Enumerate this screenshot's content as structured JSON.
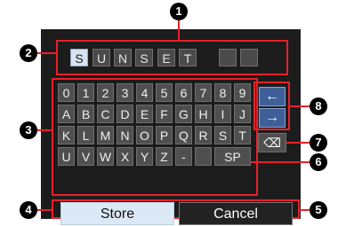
{
  "name_field": {
    "chars": [
      "S",
      "U",
      "N",
      "S",
      "E",
      "T",
      "",
      ""
    ]
  },
  "keyboard": {
    "rows": [
      [
        "0",
        "1",
        "2",
        "3",
        "4",
        "5",
        "6",
        "7",
        "8",
        "9"
      ],
      [
        "A",
        "B",
        "C",
        "D",
        "E",
        "F",
        "G",
        "H",
        "I",
        "J"
      ],
      [
        "K",
        "L",
        "M",
        "N",
        "O",
        "P",
        "Q",
        "R",
        "S",
        "T"
      ],
      [
        "U",
        "V",
        "W",
        "X",
        "Y",
        "Z",
        "-",
        "",
        "SP"
      ]
    ],
    "left_arrow": "←",
    "right_arrow": "→",
    "backspace": "⌫"
  },
  "buttons": {
    "store_label": "Store",
    "cancel_label": "Cancel"
  },
  "callouts": [
    "1",
    "2",
    "3",
    "4",
    "5",
    "6",
    "7",
    "8"
  ],
  "colors": {
    "annotation": "#e8202a",
    "selected_char_bg": "#d5e4f2",
    "arrow_key_bg": "#3f5f99",
    "store_bg": "#dbe9f6"
  }
}
